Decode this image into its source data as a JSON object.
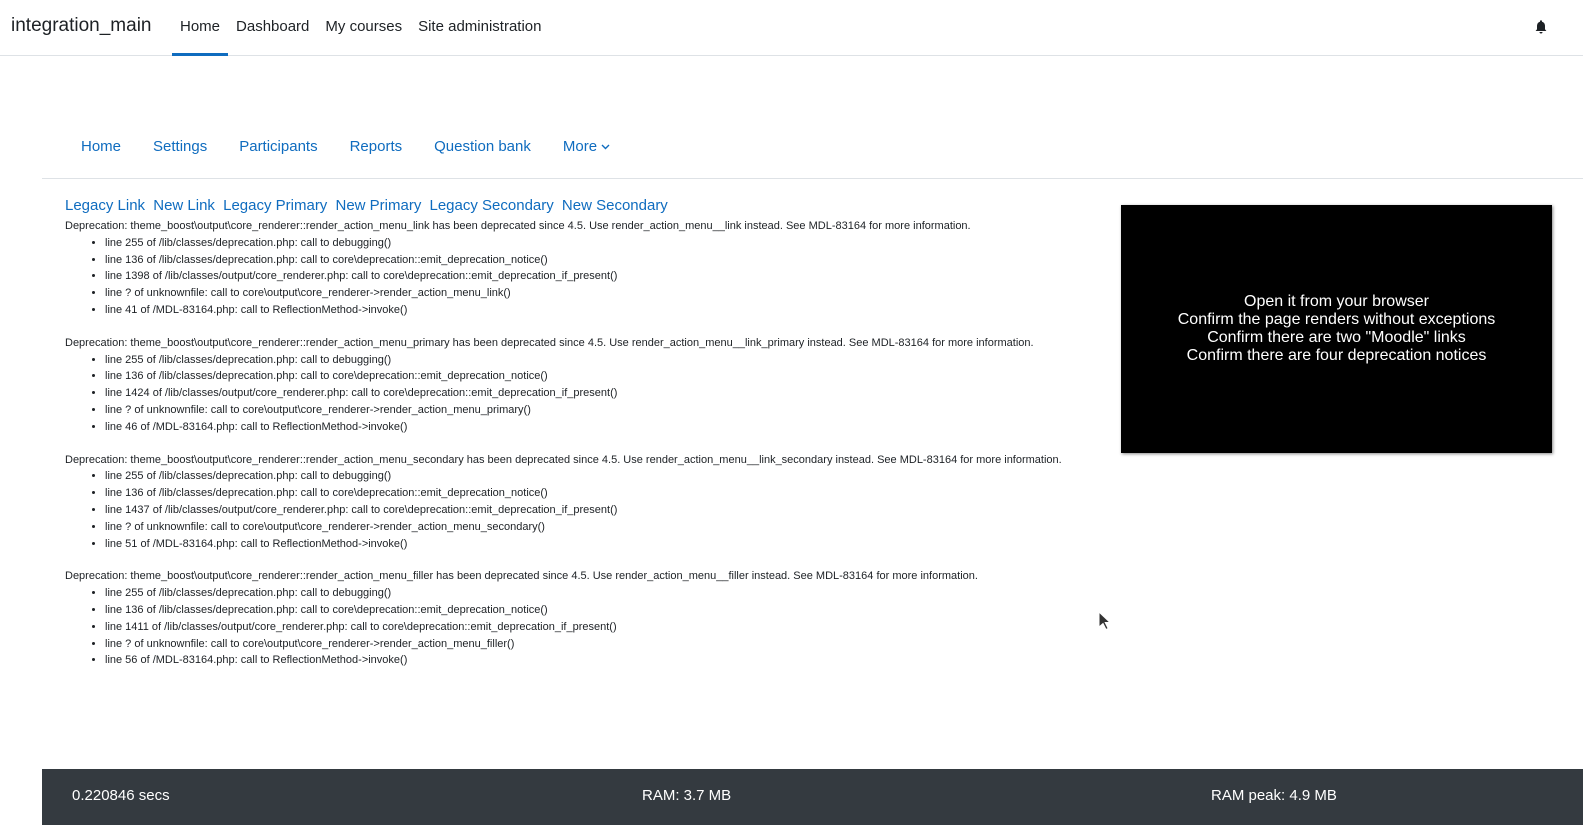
{
  "navbar": {
    "brand": "integration_main",
    "items": [
      {
        "label": "Home",
        "active": true
      },
      {
        "label": "Dashboard"
      },
      {
        "label": "My courses"
      },
      {
        "label": "Site administration"
      }
    ],
    "notification_icon": "bell-icon"
  },
  "secondary_nav": {
    "items": [
      "Home",
      "Settings",
      "Participants",
      "Reports",
      "Question bank"
    ],
    "more_label": "More",
    "more_icon": "chevron-down-icon"
  },
  "links": [
    "Legacy Link",
    "New Link",
    "Legacy Primary",
    "New Primary",
    "Legacy Secondary",
    "New Secondary"
  ],
  "notices": [
    {
      "message": "Deprecation: theme_boost\\output\\core_renderer::render_action_menu_link has been deprecated since 4.5. Use render_action_menu__link instead. See MDL-83164 for more information.",
      "trace": [
        "line 255 of /lib/classes/deprecation.php: call to debugging()",
        "line 136 of /lib/classes/deprecation.php: call to core\\deprecation::emit_deprecation_notice()",
        "line 1398 of /lib/classes/output/core_renderer.php: call to core\\deprecation::emit_deprecation_if_present()",
        "line ? of unknownfile: call to core\\output\\core_renderer->render_action_menu_link()",
        "line 41 of /MDL-83164.php: call to ReflectionMethod->invoke()"
      ]
    },
    {
      "message": "Deprecation: theme_boost\\output\\core_renderer::render_action_menu_primary has been deprecated since 4.5. Use render_action_menu__link_primary instead. See MDL-83164 for more information.",
      "trace": [
        "line 255 of /lib/classes/deprecation.php: call to debugging()",
        "line 136 of /lib/classes/deprecation.php: call to core\\deprecation::emit_deprecation_notice()",
        "line 1424 of /lib/classes/output/core_renderer.php: call to core\\deprecation::emit_deprecation_if_present()",
        "line ? of unknownfile: call to core\\output\\core_renderer->render_action_menu_primary()",
        "line 46 of /MDL-83164.php: call to ReflectionMethod->invoke()"
      ]
    },
    {
      "message": "Deprecation: theme_boost\\output\\core_renderer::render_action_menu_secondary has been deprecated since 4.5. Use render_action_menu__link_secondary instead. See MDL-83164 for more information.",
      "trace": [
        "line 255 of /lib/classes/deprecation.php: call to debugging()",
        "line 136 of /lib/classes/deprecation.php: call to core\\deprecation::emit_deprecation_notice()",
        "line 1437 of /lib/classes/output/core_renderer.php: call to core\\deprecation::emit_deprecation_if_present()",
        "line ? of unknownfile: call to core\\output\\core_renderer->render_action_menu_secondary()",
        "line 51 of /MDL-83164.php: call to ReflectionMethod->invoke()"
      ]
    },
    {
      "message": "Deprecation: theme_boost\\output\\core_renderer::render_action_menu_filler has been deprecated since 4.5. Use render_action_menu__filler instead. See MDL-83164 for more information.",
      "trace": [
        "line 255 of /lib/classes/deprecation.php: call to debugging()",
        "line 136 of /lib/classes/deprecation.php: call to core\\deprecation::emit_deprecation_notice()",
        "line 1411 of /lib/classes/output/core_renderer.php: call to core\\deprecation::emit_deprecation_if_present()",
        "line ? of unknownfile: call to core\\output\\core_renderer->render_action_menu_filler()",
        "line 56 of /MDL-83164.php: call to ReflectionMethod->invoke()"
      ]
    }
  ],
  "instructions": [
    "Open it from your browser",
    "Confirm the page renders without exceptions",
    "Confirm there are two \"Moodle\" links",
    "Confirm there are four deprecation notices"
  ],
  "footer": {
    "time": "0.220846 secs",
    "ram": "RAM: 3.7 MB",
    "ram_peak": "RAM peak: 4.9 MB"
  },
  "colors": {
    "link": "#0f6cbf",
    "footer_bg": "#343a40",
    "video_bg": "#000000"
  }
}
